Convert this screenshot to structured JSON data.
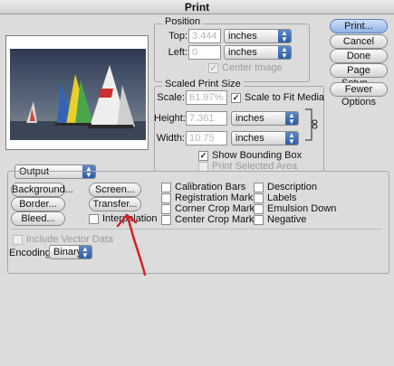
{
  "window": {
    "title": "Print"
  },
  "position": {
    "group_label": "Position",
    "top_label": "Top:",
    "top_value": "3.444",
    "top_unit": "inches",
    "left_label": "Left:",
    "left_value": "0",
    "left_unit": "inches",
    "center_image": "Center Image"
  },
  "scaled": {
    "group_label": "Scaled Print Size",
    "scale_label": "Scale:",
    "scale_value": "61.97%",
    "scale_to_fit": "Scale to Fit Media",
    "height_label": "Height:",
    "height_value": "7.361",
    "height_unit": "inches",
    "width_label": "Width:",
    "width_value": "10.75",
    "width_unit": "inches",
    "show_bounding_box": "Show Bounding Box",
    "print_selected_area": "Print Selected Area"
  },
  "buttons": {
    "print": "Print...",
    "cancel": "Cancel",
    "done": "Done",
    "page_setup": "Page Setup...",
    "fewer_options": "Fewer Options"
  },
  "output": {
    "dropdown_value": "Output",
    "background": "Background...",
    "border": "Border...",
    "bleed": "Bleed...",
    "screen": "Screen...",
    "transfer": "Transfer...",
    "interpolation": "Interpolation",
    "calibration_bars": "Calibration Bars",
    "registration_marks": "Registration Marks",
    "corner_crop_marks": "Corner Crop Marks",
    "center_crop_marks": "Center Crop Marks",
    "description": "Description",
    "labels": "Labels",
    "emulsion_down": "Emulsion Down",
    "negative": "Negative",
    "include_vector_data": "Include Vector Data",
    "encoding_label": "Encoding:",
    "encoding_value": "Binary"
  },
  "annotation": {
    "color": "#d8202a"
  }
}
